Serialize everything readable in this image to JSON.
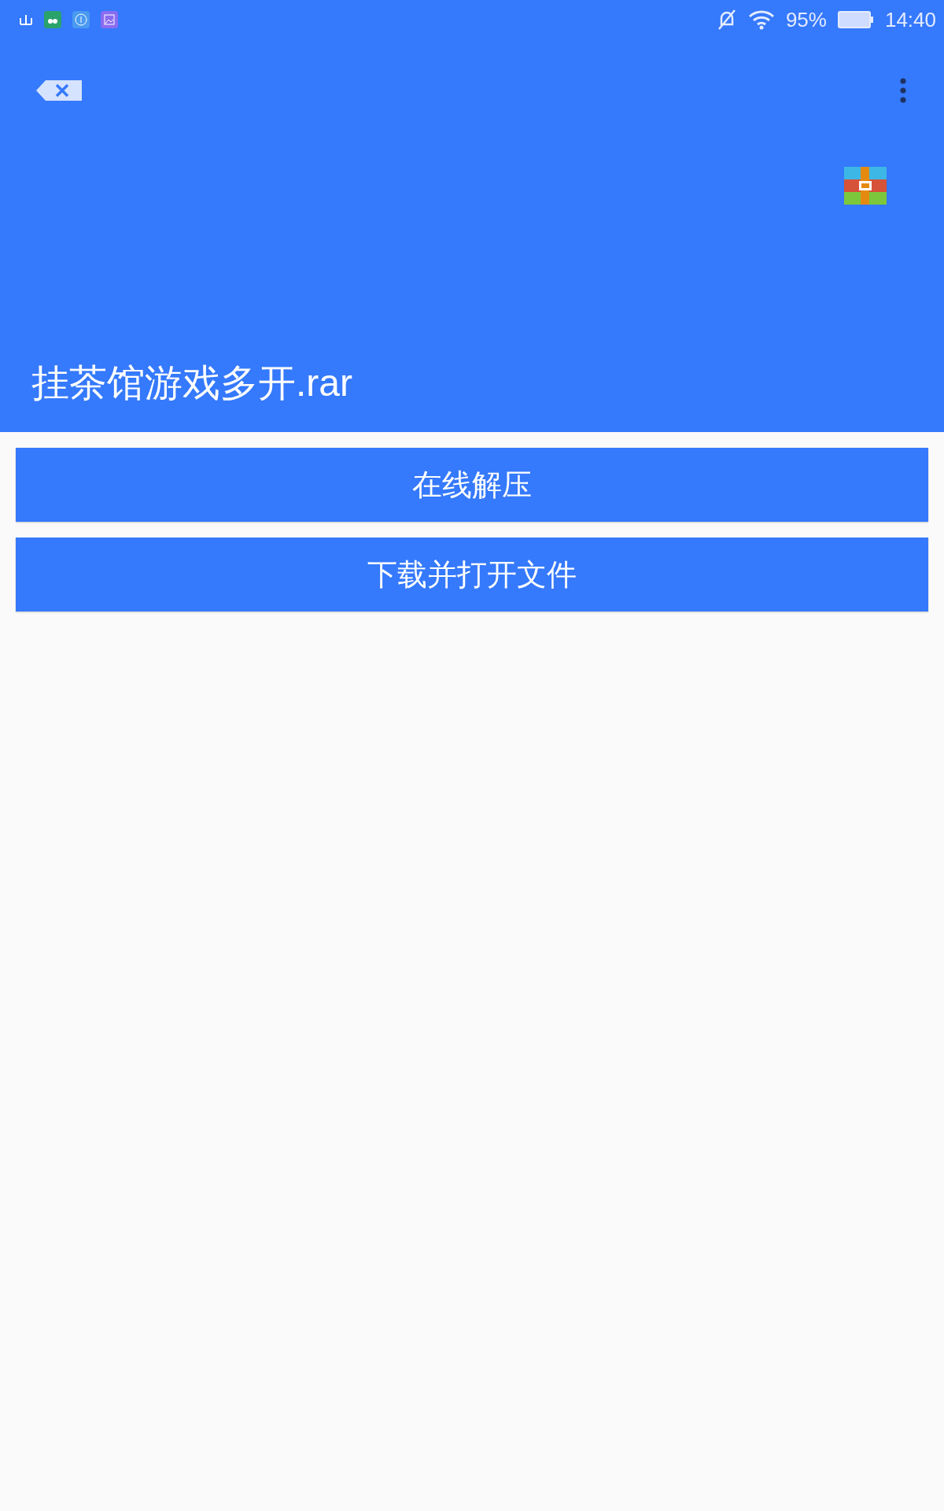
{
  "status_bar": {
    "battery": "95%",
    "time": "14:40"
  },
  "file": {
    "name": "挂茶馆游戏多开.rar"
  },
  "buttons": [
    {
      "label": "在线解压"
    },
    {
      "label": "下载并打开文件"
    }
  ]
}
